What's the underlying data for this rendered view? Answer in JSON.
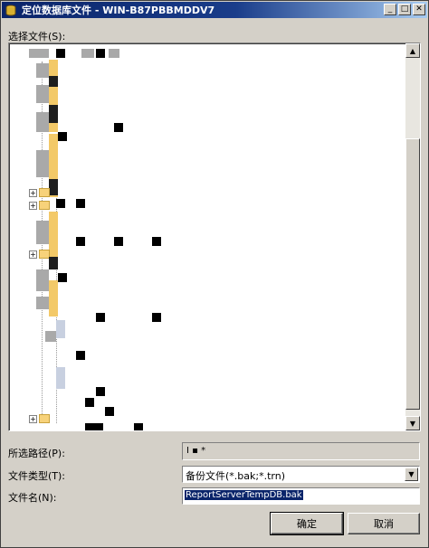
{
  "window": {
    "title": "定位数据库文件 - WIN-B87PBBMDDV7"
  },
  "select_file": {
    "label": "选择文件(S):"
  },
  "tree": {
    "scroll_up": "▲",
    "scroll_down": "▼"
  },
  "selected_path": {
    "label": "所选路径(P):",
    "value": "I ▪ *"
  },
  "file_type": {
    "label": "文件类型(T):",
    "value": "备份文件(*.bak;*.trn)",
    "arrow": "▼"
  },
  "file_name": {
    "label": "文件名(N):",
    "value": "ReportServerTempDB.bak"
  },
  "buttons": {
    "ok": "确定",
    "cancel": "取消"
  },
  "titlebar_buttons": {
    "minimize": "_",
    "maximize": "□",
    "close": "✕"
  }
}
